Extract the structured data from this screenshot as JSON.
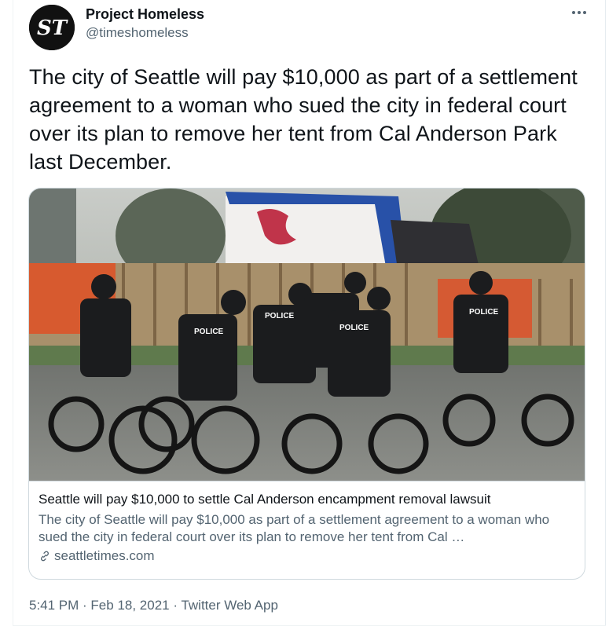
{
  "tweet": {
    "author_name": "Project Homeless",
    "author_handle": "@timeshomeless",
    "avatar_letters": "ST",
    "text": "The city of Seattle will pay $10,000 as part of a settlement agreement to a woman who sued the city in federal court over its plan to remove her tent from Cal Anderson Park last December."
  },
  "card": {
    "title": "Seattle will pay $10,000 to settle Cal Anderson encampment removal lawsuit",
    "description": "The city of Seattle will pay $10,000 as part of a settlement agreement to a woman who sued the city in federal court over its plan to remove her tent from Cal …",
    "domain": "seattletimes.com",
    "image_alt": "police officers on bicycles at an encampment"
  },
  "meta": {
    "time": "5:41 PM",
    "sep1": " · ",
    "date": "Feb 18, 2021",
    "sep2": " · ",
    "source": "Twitter Web App"
  },
  "colors": {
    "text_primary": "#0f1419",
    "text_secondary": "#536471",
    "border": "#cfd9de"
  }
}
